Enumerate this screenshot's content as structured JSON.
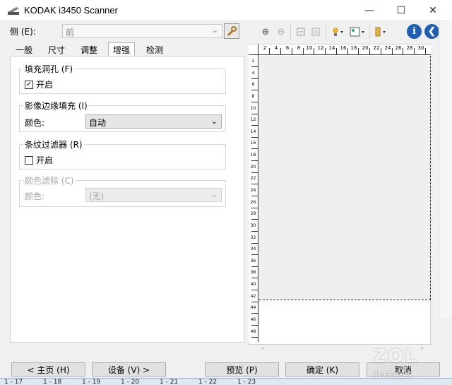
{
  "window": {
    "title": "KODAK i3450 Scanner",
    "minimize": "—",
    "maximize": "☐",
    "close": "✕"
  },
  "side": {
    "label": "侧 (E):",
    "value": "前",
    "chevron": "⌄"
  },
  "toolbar": {
    "zoom_in": "⊕",
    "zoom_out": "⊖",
    "help": "i",
    "back": "❮"
  },
  "tabs": [
    {
      "label": "一般"
    },
    {
      "label": "尺寸"
    },
    {
      "label": "调整"
    },
    {
      "label": "增强",
      "active": true
    },
    {
      "label": "检测"
    }
  ],
  "groups": {
    "fill_holes": {
      "legend": "填充洞孔 (F)",
      "checkbox_label": "开启",
      "checked": true
    },
    "edge_fill": {
      "legend": "影像边缘填充 (I)",
      "color_label": "颜色:",
      "color_value": "自动"
    },
    "streak_filter": {
      "legend": "条纹过滤器 (R)",
      "checkbox_label": "开启",
      "checked": false
    },
    "color_dropout": {
      "legend": "颜色滤除 (C)",
      "color_label": "颜色:",
      "color_value": "(无)",
      "disabled": true
    }
  },
  "ruler": {
    "top_ticks": [
      "2",
      "4",
      "6",
      "8",
      "10",
      "12",
      "14",
      "16",
      "18",
      "20",
      "22",
      "24",
      "26",
      "28",
      "30"
    ],
    "left_ticks": [
      "2",
      "4",
      "6",
      "8",
      "10",
      "12",
      "14",
      "16",
      "18",
      "20",
      "22",
      "24",
      "26",
      "28",
      "30",
      "32",
      "34",
      "36",
      "38",
      "40",
      "42",
      "44",
      "46",
      "48"
    ]
  },
  "buttons": {
    "home": "< 主页 (H)",
    "device": "设备 (V) >",
    "preview": "预览 (P)",
    "ok": "确定 (K)",
    "cancel": "取消"
  },
  "background_strip": [
    "1 - 17",
    "1 - 18",
    "1 - 19",
    "1 - 20",
    "1 - 21",
    "1 - 22",
    "1 - 23"
  ],
  "watermark": {
    "logo": "ZOL",
    "subtitle": "中关村在线"
  },
  "colors": {
    "accent": "#1f5fb4",
    "dash": "#333333"
  }
}
